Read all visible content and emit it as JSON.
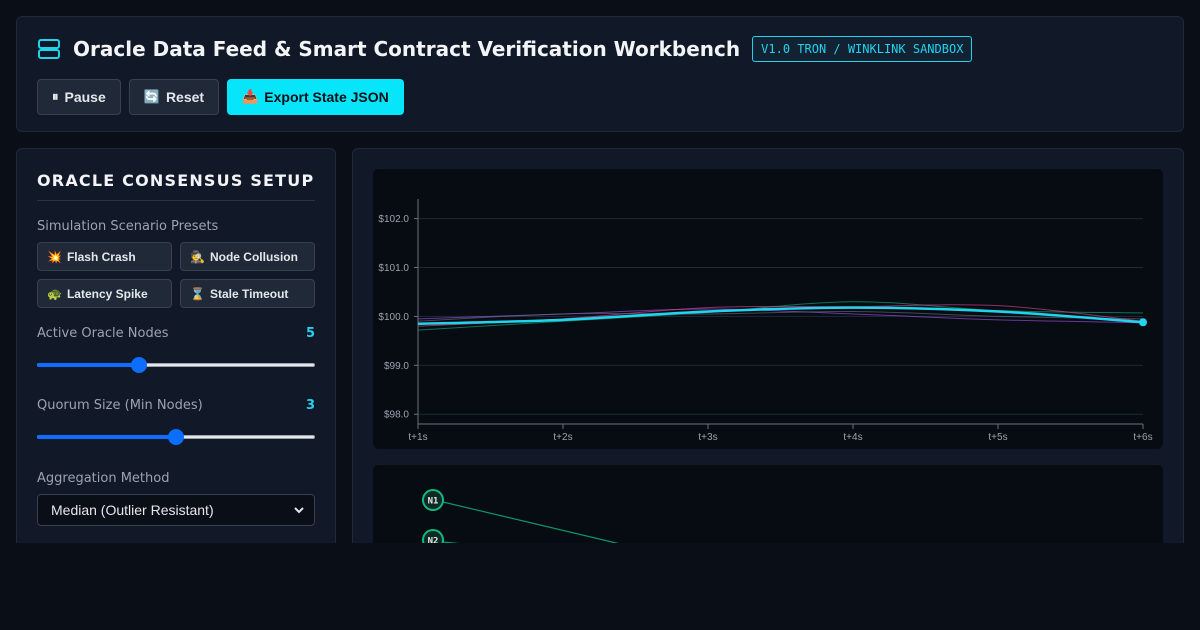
{
  "header": {
    "title": "Oracle Data Feed & Smart Contract Verification Workbench",
    "badge": "V1.0 TRON / WINKLINK SANDBOX",
    "icon": "server-icon",
    "buttons": {
      "pause": {
        "icon": "⏸",
        "label": "Pause"
      },
      "reset": {
        "icon": "🔄",
        "label": "Reset"
      },
      "export": {
        "icon": "📥",
        "label": "Export State JSON"
      }
    }
  },
  "sidebar": {
    "title": "ORACLE CONSENSUS SETUP",
    "presets_label": "Simulation Scenario Presets",
    "presets": [
      {
        "icon": "💥",
        "label": "Flash Crash"
      },
      {
        "icon": "🕵",
        "label": "Node Collusion"
      },
      {
        "icon": "🐢",
        "label": "Latency Spike"
      },
      {
        "icon": "⌛",
        "label": "Stale Timeout"
      }
    ],
    "active_nodes": {
      "label": "Active Oracle Nodes",
      "value": "5",
      "fraction": 0.36
    },
    "quorum": {
      "label": "Quorum Size (Min Nodes)",
      "value": "3",
      "fraction": 0.5
    },
    "aggregation": {
      "label": "Aggregation Method",
      "selected": "Median (Outlier Resistant)"
    }
  },
  "chart_data": {
    "type": "line",
    "x": [
      "t+1s",
      "t+2s",
      "t+3s",
      "t+4s",
      "t+5s",
      "t+6s"
    ],
    "ylim": [
      97.8,
      102.4
    ],
    "yticks": [
      98.0,
      99.0,
      100.0,
      101.0,
      102.0
    ],
    "ytick_labels": [
      "$98.0",
      "$99.0",
      "$100.0",
      "$101.0",
      "$102.0"
    ],
    "grid": true,
    "colors": {
      "aggregate": "#22d3ee",
      "node_a": "#10b981",
      "node_b": "#a855f7",
      "node_c": "#ec4899",
      "node_d": "#6b7280"
    },
    "series": [
      {
        "values": [
          99.85,
          99.93,
          100.1,
          100.18,
          100.1,
          99.88
        ],
        "key": "aggregate"
      },
      {
        "values": [
          99.72,
          99.9,
          100.08,
          100.3,
          100.12,
          100.07
        ],
        "key": "node_a"
      },
      {
        "values": [
          99.95,
          100.05,
          100.15,
          100.05,
          99.93,
          99.87
        ],
        "key": "node_b"
      },
      {
        "values": [
          99.8,
          99.95,
          100.18,
          100.2,
          100.22,
          99.9
        ],
        "key": "node_c"
      },
      {
        "values": [
          99.9,
          100.05,
          100.05,
          100.1,
          100.0,
          99.95
        ],
        "key": "node_d"
      }
    ]
  },
  "network": {
    "nodes": [
      "N1",
      "N2"
    ],
    "color": "#10b981"
  }
}
